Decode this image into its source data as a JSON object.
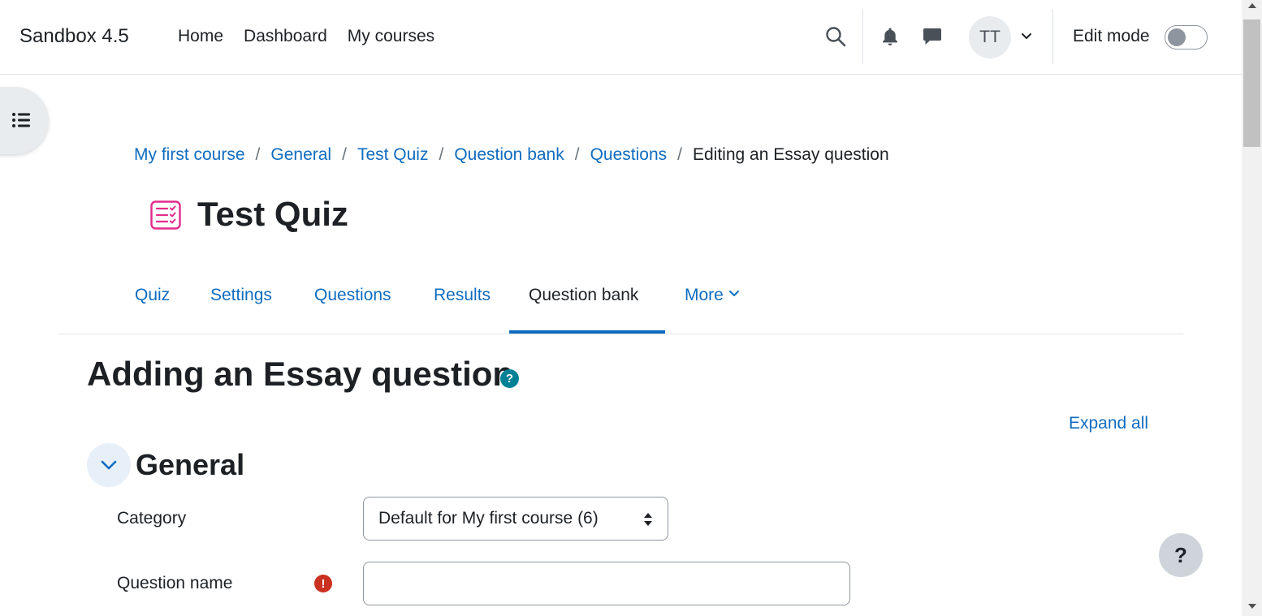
{
  "navbar": {
    "brand": "Sandbox 4.5",
    "links": [
      "Home",
      "Dashboard",
      "My courses"
    ],
    "avatar_initials": "TT",
    "edit_mode_label": "Edit mode",
    "edit_mode_on": false
  },
  "breadcrumb": {
    "items": [
      "My first course",
      "General",
      "Test Quiz",
      "Question bank",
      "Questions"
    ],
    "current": "Editing an Essay question",
    "separator": "/"
  },
  "page": {
    "title": "Test Quiz",
    "icon": "quiz-icon",
    "accent_color": "#e22b8c"
  },
  "secondary_nav": {
    "tabs": [
      "Quiz",
      "Settings",
      "Questions",
      "Results",
      "Question bank",
      "More"
    ],
    "active": "Question bank"
  },
  "form": {
    "heading": "Adding an Essay question",
    "help_glyph": "?",
    "expand_all": "Expand all",
    "section_title": "General",
    "category_label": "Category",
    "category_value": "Default for My first course (6)",
    "question_name_label": "Question name",
    "question_name_value": "",
    "required_glyph": "!"
  },
  "help_fab": "?",
  "colors": {
    "link": "#0f6cbf",
    "help": "#008196",
    "required": "#ca3120"
  }
}
